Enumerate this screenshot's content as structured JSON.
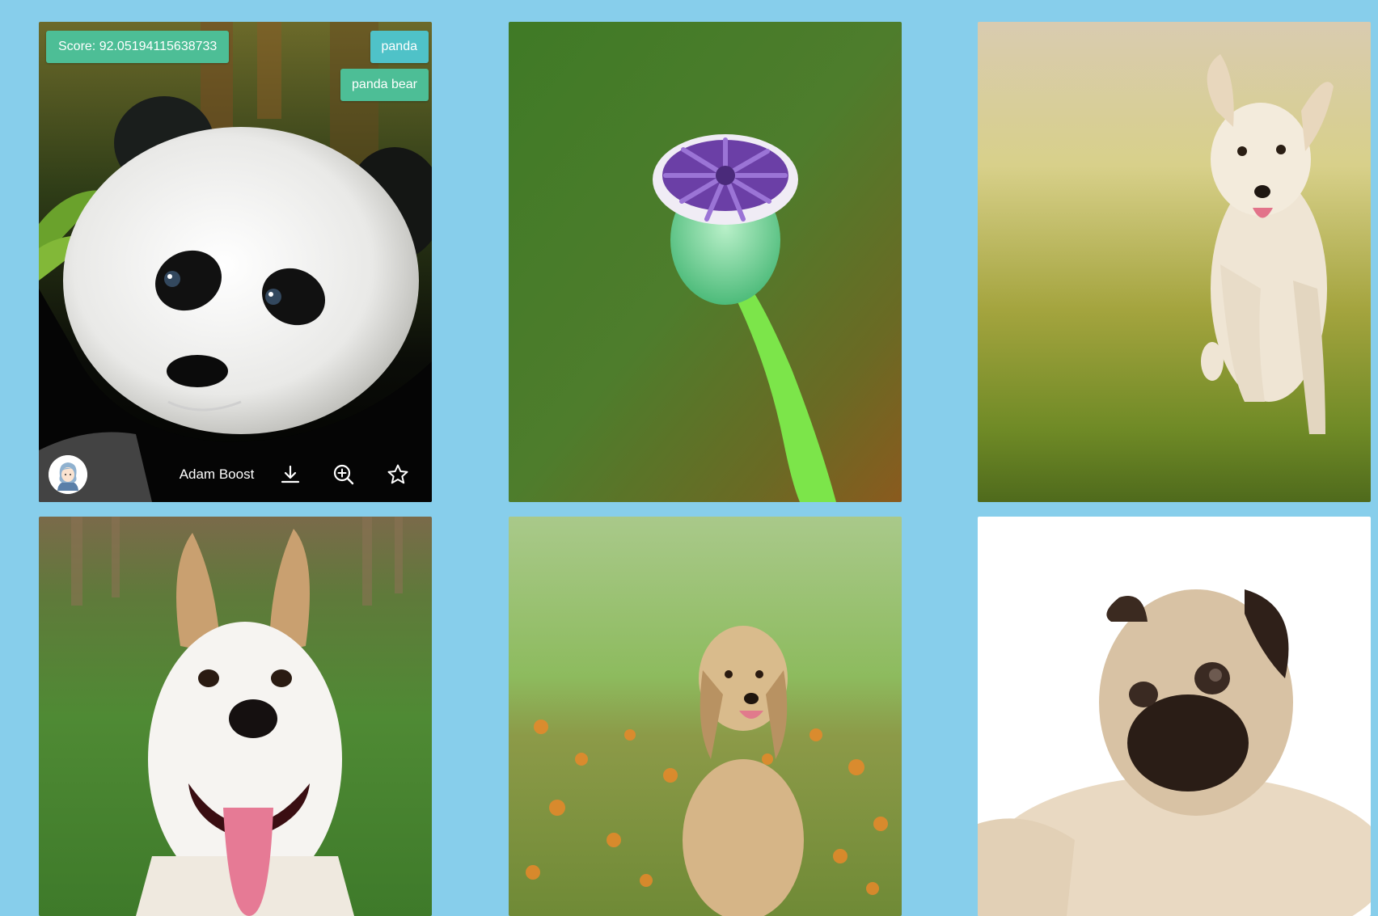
{
  "cards": [
    {
      "subject": "panda",
      "score_label": "Score: 92.05194115638733",
      "tags": [
        "panda",
        "panda bear"
      ],
      "author": "Adam Boost",
      "actions": [
        "download-icon",
        "zoom-in-icon",
        "star-icon"
      ]
    },
    {
      "subject": "poppy seed head"
    },
    {
      "subject": "running puppy"
    },
    {
      "subject": "smiling dog"
    },
    {
      "subject": "golden retriever puppy"
    },
    {
      "subject": "pug"
    }
  ],
  "colors": {
    "page_background": "#87CEEB",
    "badge": "#4DBE96",
    "tag_highlight": "#4FC2C8"
  }
}
